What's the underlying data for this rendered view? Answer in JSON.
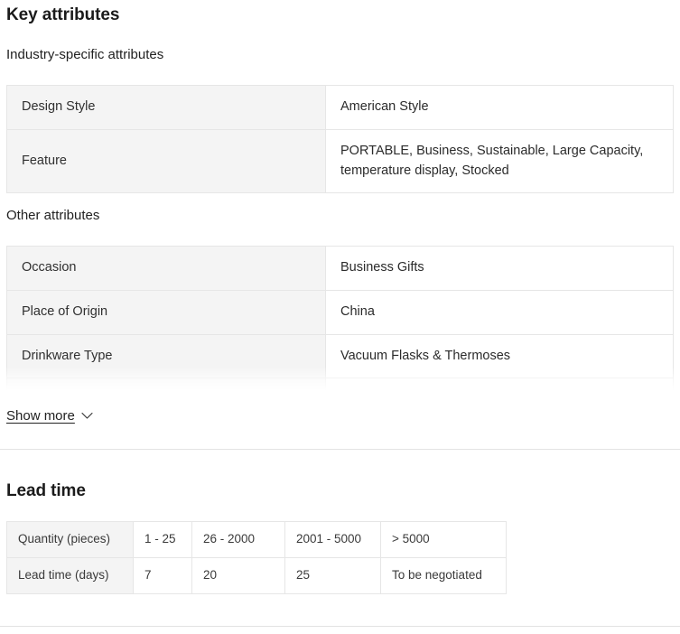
{
  "key_attributes": {
    "title": "Key attributes",
    "industry_section": {
      "subtitle": "Industry-specific attributes",
      "rows": [
        {
          "name": "Design Style",
          "value": "American Style"
        },
        {
          "name": "Feature",
          "value": "PORTABLE, Business, Sustainable, Large Capacity, temperature display, Stocked"
        }
      ]
    },
    "other_section": {
      "subtitle": "Other attributes",
      "rows": [
        {
          "name": "Occasion",
          "value": "Business Gifts"
        },
        {
          "name": "Place of Origin",
          "value": "China"
        },
        {
          "name": "Drinkware Type",
          "value": "Vacuum Flasks & Thermoses"
        },
        {
          "name": "",
          "value": ""
        }
      ]
    },
    "show_more": {
      "label": "Show more",
      "icon": "chevron-down-icon"
    }
  },
  "lead_time": {
    "title": "Lead time",
    "rows": [
      {
        "header": "Quantity (pieces)",
        "cells": [
          "1 - 25",
          "26 - 2000",
          "2001 - 5000",
          "> 5000"
        ]
      },
      {
        "header": "Lead time (days)",
        "cells": [
          "7",
          "20",
          "25",
          "To be negotiated"
        ]
      }
    ]
  },
  "colors": {
    "page_background": "#ffffff",
    "cell_header_background": "#f4f4f4",
    "border": "#e6e6e6",
    "divider": "#e3e3e3",
    "text": "#222222"
  }
}
